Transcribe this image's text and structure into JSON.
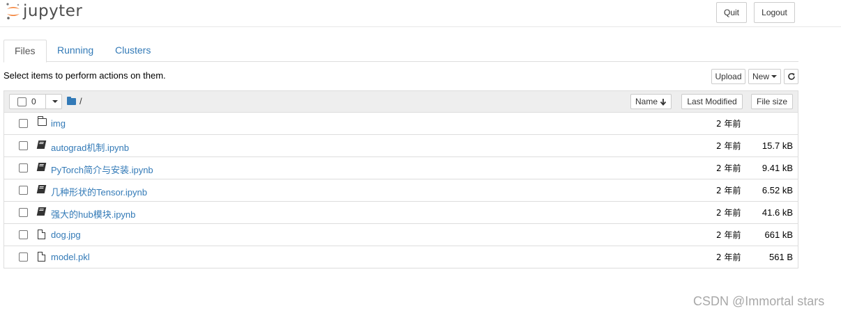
{
  "header": {
    "logo_text": "jupyter",
    "quit_label": "Quit",
    "logout_label": "Logout"
  },
  "tabs": [
    {
      "label": "Files",
      "active": true
    },
    {
      "label": "Running",
      "active": false
    },
    {
      "label": "Clusters",
      "active": false
    }
  ],
  "toolbar": {
    "instruction": "Select items to perform actions on them.",
    "upload_label": "Upload",
    "new_label": "New",
    "refresh_icon": "refresh-icon"
  },
  "list_header": {
    "selected_count": "0",
    "path": "/",
    "sort_name_label": "Name",
    "sort_modified_label": "Last Modified",
    "sort_size_label": "File size"
  },
  "files": [
    {
      "name": "img",
      "type": "folder",
      "modified": "2 年前",
      "size": ""
    },
    {
      "name": "autograd机制.ipynb",
      "type": "notebook",
      "modified": "2 年前",
      "size": "15.7 kB"
    },
    {
      "name": "PyTorch简介与安装.ipynb",
      "type": "notebook",
      "modified": "2 年前",
      "size": "9.41 kB"
    },
    {
      "name": "几种形状的Tensor.ipynb",
      "type": "notebook",
      "modified": "2 年前",
      "size": "6.52 kB"
    },
    {
      "name": "强大的hub模块.ipynb",
      "type": "notebook",
      "modified": "2 年前",
      "size": "41.6 kB"
    },
    {
      "name": "dog.jpg",
      "type": "file",
      "modified": "2 年前",
      "size": "661 kB"
    },
    {
      "name": "model.pkl",
      "type": "file",
      "modified": "2 年前",
      "size": "561 B"
    }
  ],
  "watermark": "CSDN @Immortal stars",
  "colors": {
    "link": "#337ab7",
    "logo_orange": "#f37726",
    "header_bg": "#eeeeee"
  }
}
